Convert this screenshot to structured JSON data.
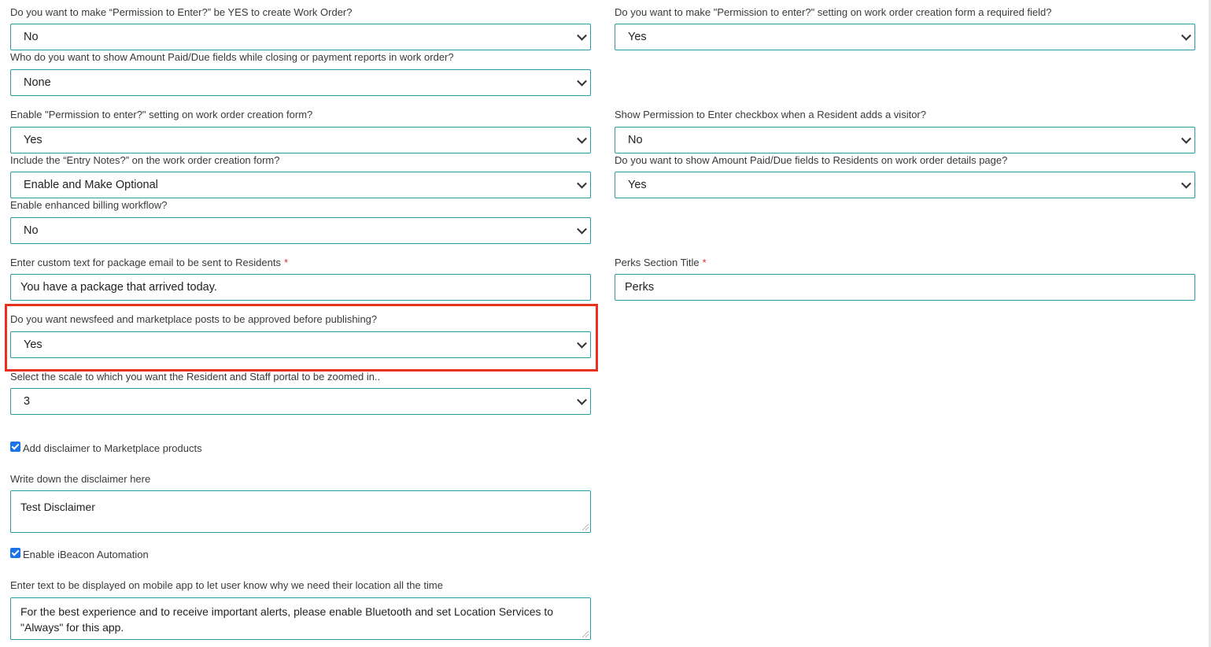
{
  "fields": {
    "perm_enter_yes_wo": {
      "label": "Do you want to make “Permission to Enter?” be YES to create Work Order?",
      "value": "No"
    },
    "perm_enter_required": {
      "label": "Do you want to make \"Permission to enter?\" setting on work order creation form a required field?",
      "value": "Yes"
    },
    "amount_paid_closing": {
      "label": "Who do you want to show Amount Paid/Due fields while closing or payment reports in work order?",
      "value": "None"
    },
    "perm_enter_enable": {
      "label": "Enable \"Permission to enter?\" setting on work order creation form?",
      "value": "Yes"
    },
    "perm_enter_visitor": {
      "label": "Show Permission to Enter checkbox when a Resident adds a visitor?",
      "value": "No"
    },
    "entry_notes": {
      "label": "Include the “Entry Notes?” on the work order creation form?",
      "value": "Enable and Make Optional"
    },
    "amount_paid_residents": {
      "label": "Do you want to show Amount Paid/Due fields to Residents on work order details page?",
      "value": "Yes"
    },
    "enhanced_billing": {
      "label": "Enable enhanced billing workflow?",
      "value": "No"
    },
    "package_email_text": {
      "label": "Enter custom text for package email to be sent to Residents",
      "required_mark": "*",
      "value": "You have a package that arrived today."
    },
    "perks_title": {
      "label": "Perks Section Title",
      "required_mark": "*",
      "value": "Perks"
    },
    "posts_approval": {
      "label": "Do you want newsfeed and marketplace posts to be approved before publishing?",
      "value": "Yes"
    },
    "zoom_scale": {
      "label": "Select the scale to which you want the Resident and Staff portal to be zoomed in..",
      "value": "3"
    },
    "marketplace_disclaimer": {
      "label": "Add disclaimer to Marketplace products",
      "checked": true
    },
    "disclaimer_text": {
      "label": "Write down the disclaimer here",
      "value": "Test Disclaimer"
    },
    "ibeacon": {
      "label": "Enable iBeacon Automation",
      "checked": true
    },
    "location_text": {
      "label": "Enter text to be displayed on mobile app to let user know why we need their location all the time",
      "value": "For the best experience and to receive important alerts, please enable Bluetooth and set Location Services to \"Always\" for this app."
    }
  },
  "colors": {
    "border": "#2b9aa3",
    "highlight": "#e8321f",
    "required": "#d32f2f",
    "checkbox": "#1a73e8"
  }
}
